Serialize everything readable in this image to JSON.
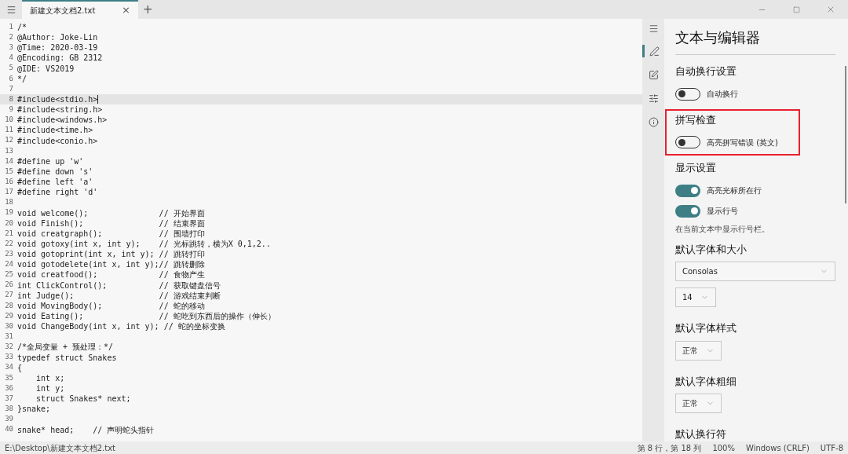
{
  "window": {
    "tabs": [
      {
        "title": "新建文本文档2.txt",
        "selected": true,
        "close": "×"
      }
    ],
    "new_tab": "+"
  },
  "editor": {
    "lines": [
      {
        "number": "1",
        "text": "/*",
        "current": false
      },
      {
        "number": "2",
        "text": "@Author: Joke-Lin",
        "current": false
      },
      {
        "number": "3",
        "text": "@Time: 2020-03-19",
        "current": false
      },
      {
        "number": "4",
        "text": "@Encoding: GB 2312",
        "current": false
      },
      {
        "number": "5",
        "text": "@IDE: VS2019",
        "current": false
      },
      {
        "number": "6",
        "text": "*/",
        "current": false
      },
      {
        "number": "7",
        "current": false
      },
      {
        "number": "8",
        "text": "#include<stdio.h>",
        "current": true
      },
      {
        "number": "9",
        "text": "#include<string.h>",
        "current": false
      },
      {
        "number": "10",
        "text": "#include<windows.h>",
        "current": false
      },
      {
        "number": "11",
        "text": "#include<time.h>",
        "current": false
      },
      {
        "number": "12",
        "text": "#include<conio.h>",
        "current": false
      },
      {
        "number": "13",
        "current": false
      },
      {
        "number": "14",
        "text": "#define up 'w'",
        "current": false
      },
      {
        "number": "15",
        "text": "#define down 's'",
        "current": false
      },
      {
        "number": "16",
        "text": "#define left 'a'",
        "current": false
      },
      {
        "number": "17",
        "text": "#define right 'd'",
        "current": false
      },
      {
        "number": "18",
        "current": false
      },
      {
        "number": "19",
        "text": "void welcome();               // 开始界面",
        "current": false
      },
      {
        "number": "20",
        "text": "void Finish();                // 结束界面",
        "current": false
      },
      {
        "number": "21",
        "text": "void creatgraph();            // 围墙打印",
        "current": false
      },
      {
        "number": "22",
        "text": "void gotoxy(int x, int y);    // 光标跳转，横为X 0,1,2..",
        "current": false
      },
      {
        "number": "23",
        "text": "void gotoprint(int x, int y); // 跳转打印",
        "current": false
      },
      {
        "number": "24",
        "text": "void gotodelete(int x, int y);// 跳转删除",
        "current": false
      },
      {
        "number": "25",
        "text": "void creatfood();             // 食物产生",
        "current": false
      },
      {
        "number": "26",
        "text": "int ClickControl();           // 获取键盘信号",
        "current": false
      },
      {
        "number": "27",
        "text": "int Judge();                  // 游戏结束判断",
        "current": false
      },
      {
        "number": "28",
        "text": "void MovingBody();            // 蛇的移动",
        "current": false
      },
      {
        "number": "29",
        "text": "void Eating();                // 蛇吃到东西后的操作（伸长）",
        "current": false
      },
      {
        "number": "30",
        "text": "void ChangeBody(int x, int y); // 蛇的坐标变换",
        "current": false
      },
      {
        "number": "31",
        "current": false
      },
      {
        "number": "32",
        "text": "/*全局变量 + 预处理：*/",
        "current": false
      },
      {
        "number": "33",
        "text": "typedef struct Snakes",
        "current": false
      },
      {
        "number": "34",
        "text": "{",
        "current": false
      },
      {
        "number": "35",
        "text": "    int x;",
        "current": false
      },
      {
        "number": "36",
        "text": "    int y;",
        "current": false
      },
      {
        "number": "37",
        "text": "    struct Snakes* next;",
        "current": false
      },
      {
        "number": "38",
        "text": "}snake;",
        "current": false
      },
      {
        "number": "39",
        "current": false
      },
      {
        "number": "40",
        "text": "snake* head;    // 声明蛇头指针",
        "current": false
      }
    ]
  },
  "settings": {
    "nav": [
      {
        "kind": "text",
        "selected": true
      },
      {
        "kind": "appearance",
        "selected": false
      },
      {
        "kind": "advanced",
        "selected": false
      },
      {
        "kind": "about",
        "selected": false
      }
    ],
    "title": "文本与编辑器",
    "sections": [
      {
        "heading": "自动换行设置",
        "highlighted": false,
        "items": [
          {
            "kind": "toggle",
            "label": "自动换行",
            "on": false
          }
        ]
      },
      {
        "heading": "拼写检查",
        "highlighted": true,
        "items": [
          {
            "kind": "toggle",
            "label": "高亮拼写错误 (英文)",
            "on": false
          }
        ]
      },
      {
        "heading": "显示设置",
        "highlighted": false,
        "items": [
          {
            "kind": "toggle",
            "label": "高亮光标所在行",
            "on": true
          },
          {
            "kind": "toggle",
            "label": "显示行号",
            "on": true
          },
          {
            "kind": "note",
            "label": "在当前文本中显示行号栏。"
          }
        ]
      },
      {
        "heading": "默认字体和大小",
        "highlighted": false,
        "items": [
          {
            "kind": "select",
            "value": "Consolas",
            "wide": true
          },
          {
            "kind": "select",
            "value": "14",
            "wide": false
          }
        ]
      },
      {
        "heading": "默认字体样式",
        "highlighted": false,
        "items": [
          {
            "kind": "select",
            "value": "正常",
            "wide": false
          }
        ]
      },
      {
        "heading": "默认字体粗细",
        "highlighted": false,
        "items": [
          {
            "kind": "select",
            "value": "正常",
            "wide": false
          }
        ]
      },
      {
        "heading": "默认换行符",
        "highlighted": false
      }
    ]
  },
  "status_bar": {
    "path": "E:\\Desktop\\新建文本文档2.txt",
    "position": "第 8 行，第 18 列",
    "zoom": "100%",
    "line_ending": "Windows (CRLF)",
    "encoding": "UTF-8"
  }
}
